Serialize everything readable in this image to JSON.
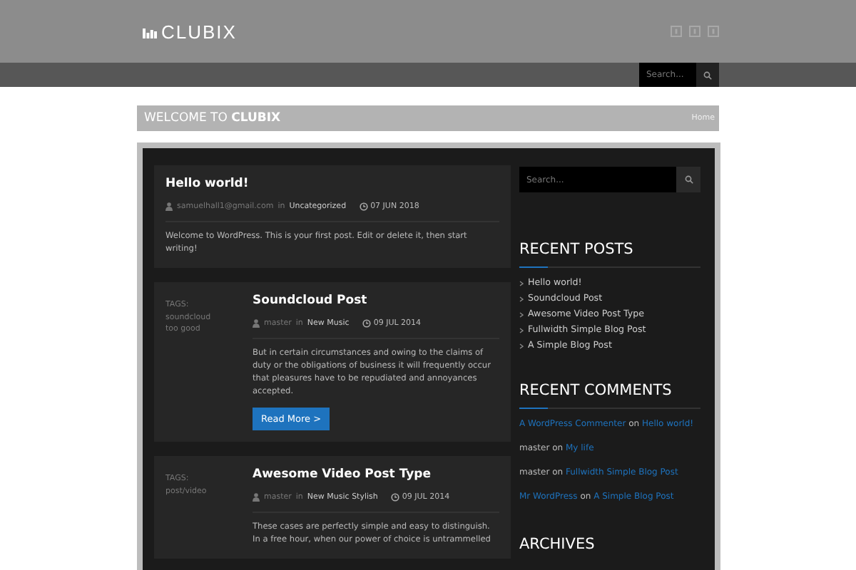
{
  "header": {
    "logo": "CLUBIX"
  },
  "nav": {
    "search": {
      "placeholder": "Search..."
    }
  },
  "page_title": {
    "prefix": "WELCOME TO ",
    "bold": "CLUBIX",
    "breadcrumb": "Home"
  },
  "posts": [
    {
      "title": "Hello world!",
      "author": "samuelhall1@gmail.com",
      "in_word": "in",
      "category": "Uncategorized",
      "date": "07 JUN 2018",
      "excerpt": "Welcome to WordPress. This is your first post. Edit or delete it, then start writing!"
    },
    {
      "title": "Soundcloud Post",
      "author": "master",
      "in_word": "in",
      "category": "New Music",
      "date": "09 JUL 2014",
      "tags_label": "TAGS:",
      "tags": [
        "soundcloud",
        "too good"
      ],
      "excerpt": "But in certain circumstances and owing to the claims of duty or the obligations of business it will frequently occur that pleasures have to be repudiated and annoyances accepted.",
      "button": "Read More >"
    },
    {
      "title": "Awesome Video Post Type",
      "author": "master",
      "in_word": "in",
      "category": "New Music Stylish",
      "date": "09 JUL 2014",
      "tags_label": "TAGS:",
      "tags": [
        "post/video"
      ],
      "excerpt": "These cases are perfectly simple and easy to distinguish. In a free hour, when our power of choice is untrammelled"
    }
  ],
  "sidebar": {
    "search": {
      "placeholder": "Search..."
    },
    "recent_posts": {
      "title": "RECENT POSTS",
      "items": [
        "Hello world!",
        "Soundcloud Post",
        "Awesome Video Post Type",
        "Fullwidth Simple Blog Post",
        "A Simple Blog Post"
      ]
    },
    "recent_comments": {
      "title": "RECENT COMMENTS",
      "items": [
        {
          "author": "A WordPress Commenter",
          "author_link": true,
          "on": "on",
          "post": "Hello world!"
        },
        {
          "author": "master",
          "author_link": false,
          "on": "on",
          "post": "My life"
        },
        {
          "author": "master",
          "author_link": false,
          "on": "on",
          "post": "Fullwidth Simple Blog Post"
        },
        {
          "author": "Mr WordPress",
          "author_link": true,
          "on": "on",
          "post": "A Simple Blog Post"
        }
      ]
    },
    "archives": {
      "title": "ARCHIVES"
    }
  }
}
